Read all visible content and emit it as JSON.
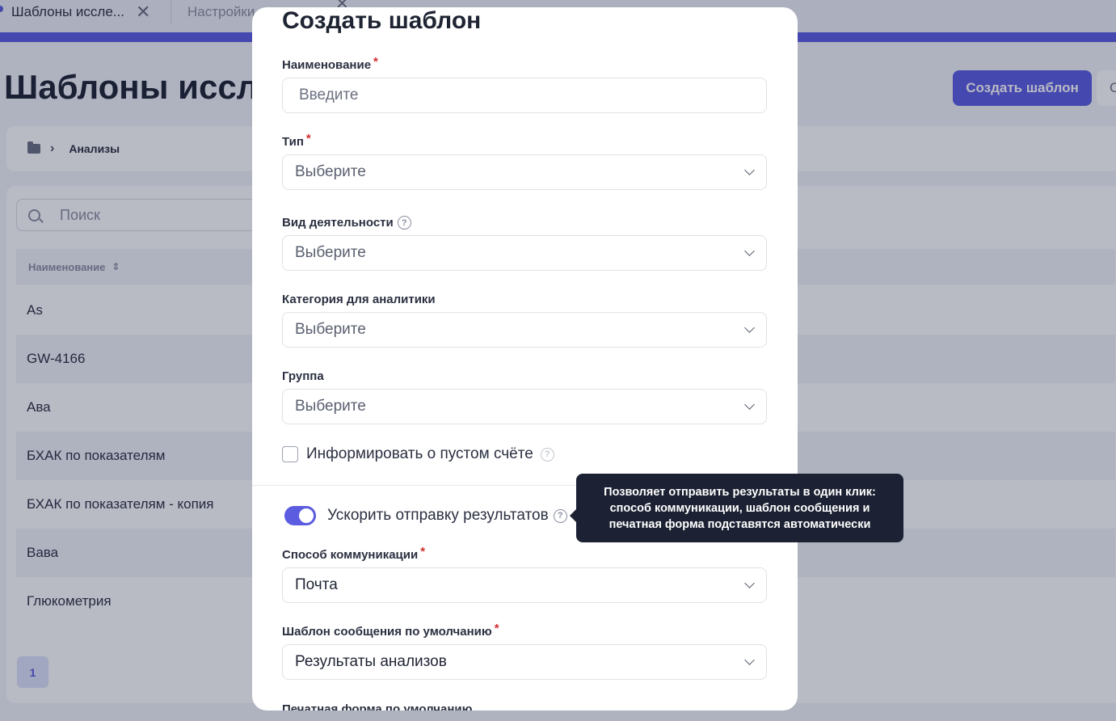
{
  "tabs": [
    {
      "label": "Шаблоны иссле..."
    },
    {
      "label": "Настройки"
    }
  ],
  "page": {
    "title": "Шаблоны иссле",
    "create_button": "Создать шаблон",
    "secondary_button": "С"
  },
  "breadcrumb": {
    "item": "Анализы"
  },
  "list": {
    "search_placeholder": "Поиск",
    "column_name": "Наименование",
    "rows": [
      "As",
      "GW-4166",
      "Ава",
      "БХАК по показателям",
      "БХАК по показателям - копия",
      "Вава",
      "Глюкометрия"
    ],
    "page_number": "1"
  },
  "modal": {
    "title": "Создать шаблон",
    "name_label": "Наименование",
    "name_placeholder": "Введите",
    "type_label": "Тип",
    "type_value": "Выберите",
    "activity_label": "Вид деятельности",
    "activity_value": "Выберите",
    "analytics_label": "Категория для аналитики",
    "analytics_value": "Выберите",
    "group_label": "Группа",
    "group_value": "Выберите",
    "notify_empty_label": "Информировать о пустом счёте",
    "speed_label": "Ускорить отправку результатов",
    "comm_label": "Способ коммуникации",
    "comm_value": "Почта",
    "msg_template_label": "Шаблон сообщения по умолчанию",
    "msg_template_value": "Результаты анализов",
    "print_form_label": "Печатная форма по умолчанию"
  },
  "tooltip": {
    "line1": "Позволяет отправить результаты в один клик:",
    "line2": "способ коммуникации, шаблон сообщения и",
    "line3": "печатная форма подставятся автоматически"
  },
  "icons": {
    "close": "close-icon",
    "folder": "folder-icon",
    "search": "search-icon",
    "sort": "sort-icon",
    "help": "help-icon",
    "chevron": "chevron-down-icon"
  },
  "colors": {
    "accent": "#5b5ce0",
    "required": "#d32f2f",
    "tooltip_bg": "#1c2233"
  },
  "state": {
    "notify_empty_checked": false,
    "speed_toggle_on": true
  }
}
